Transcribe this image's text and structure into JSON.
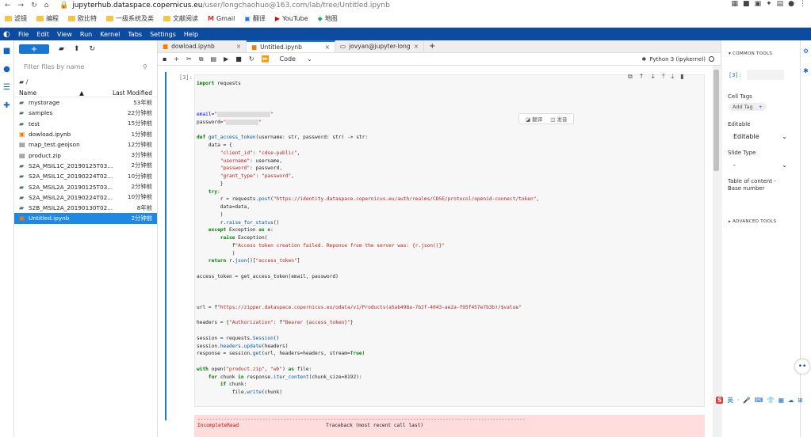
{
  "browser": {
    "nav": [
      "←",
      "→",
      "↻",
      "⌂"
    ],
    "url_host": "jupyterhub.dataspace.copernicus.eu",
    "url_path": "/user/longchaohuo@163.com/lab/tree/Untitled.ipynb",
    "extensions": [
      "▦",
      "■",
      "▣",
      "✦",
      "▤",
      "●",
      "⋮"
    ]
  },
  "bookmarks": [
    {
      "label": "滤镜",
      "icon": "folder"
    },
    {
      "label": "编程",
      "icon": "folder"
    },
    {
      "label": "欧比特",
      "icon": "folder"
    },
    {
      "label": "一级系统及类",
      "icon": "folder"
    },
    {
      "label": "文献阅读",
      "icon": "folder"
    },
    {
      "label": "Gmail",
      "icon": "gmail"
    },
    {
      "label": "翻译",
      "icon": "translate"
    },
    {
      "label": "YouTube",
      "icon": "youtube"
    },
    {
      "label": "地图",
      "icon": "map"
    }
  ],
  "menu": [
    "File",
    "Edit",
    "View",
    "Run",
    "Kernel",
    "Tabs",
    "Settings",
    "Help"
  ],
  "filebrowser": {
    "new_label": "+",
    "search_placeholder": "Filter files by name",
    "path": "/",
    "col_name": "Name",
    "col_modified": "Last Modified",
    "files": [
      {
        "name": "mystorage",
        "modified": "53年前",
        "type": "folder"
      },
      {
        "name": "samples",
        "modified": "22分钟前",
        "type": "folder"
      },
      {
        "name": "test",
        "modified": "15分钟前",
        "type": "folder"
      },
      {
        "name": "dowload.ipynb",
        "modified": "1分钟前",
        "type": "notebook"
      },
      {
        "name": "map_test.geojson",
        "modified": "12分钟前",
        "type": "file"
      },
      {
        "name": "product.zip",
        "modified": "3分钟前",
        "type": "file"
      },
      {
        "name": "S2A_MSIL1C_20190125T03...",
        "modified": "2分钟前",
        "type": "folder"
      },
      {
        "name": "S2A_MSIL1C_20190224T02...",
        "modified": "10分钟前",
        "type": "folder"
      },
      {
        "name": "S2A_MSIL2A_20190125T03...",
        "modified": "2分钟前",
        "type": "folder"
      },
      {
        "name": "S2A_MSIL2A_20190224T02...",
        "modified": "10分钟前",
        "type": "folder"
      },
      {
        "name": "S2B_MSIL2A_20190130T02...",
        "modified": "8年前",
        "type": "folder"
      },
      {
        "name": "Untitled.ipynb",
        "modified": "2分钟前",
        "type": "notebook",
        "selected": true
      }
    ]
  },
  "tabs": [
    {
      "label": "dowload.ipynb",
      "active": false
    },
    {
      "label": "Untitled.ipynb",
      "active": true
    },
    {
      "label": "jovyan@jupyter-longchaohuo",
      "active": false
    }
  ],
  "toolbar": {
    "cell_type": "Code",
    "kernel": "Python 3 (ipykernel)"
  },
  "cell": {
    "prompt": "[3]:",
    "popup_translate": "翻译",
    "popup_send": "发音"
  },
  "error": {
    "dashes": "---------------------------------------------------------------------------------------------------------------",
    "name": "IncompleteRead",
    "traceback": "Traceback (most recent call last)"
  },
  "right_panel": {
    "common_tools": "COMMON TOOLS",
    "prompt": "[3]:",
    "cell_tags": "Cell Tags",
    "add_tag": "Add Tag",
    "editable_label": "Editable",
    "editable_value": "Editable",
    "slide_label": "Slide Type",
    "slide_value": "-",
    "toc": "Table of content - Base number",
    "advanced": "ADVANCED TOOLS"
  },
  "ime": {
    "brand": "S",
    "items": [
      "英",
      "·",
      "♪",
      "🎤",
      "⌨",
      "👕",
      "▦",
      "☁",
      "⊞"
    ]
  }
}
